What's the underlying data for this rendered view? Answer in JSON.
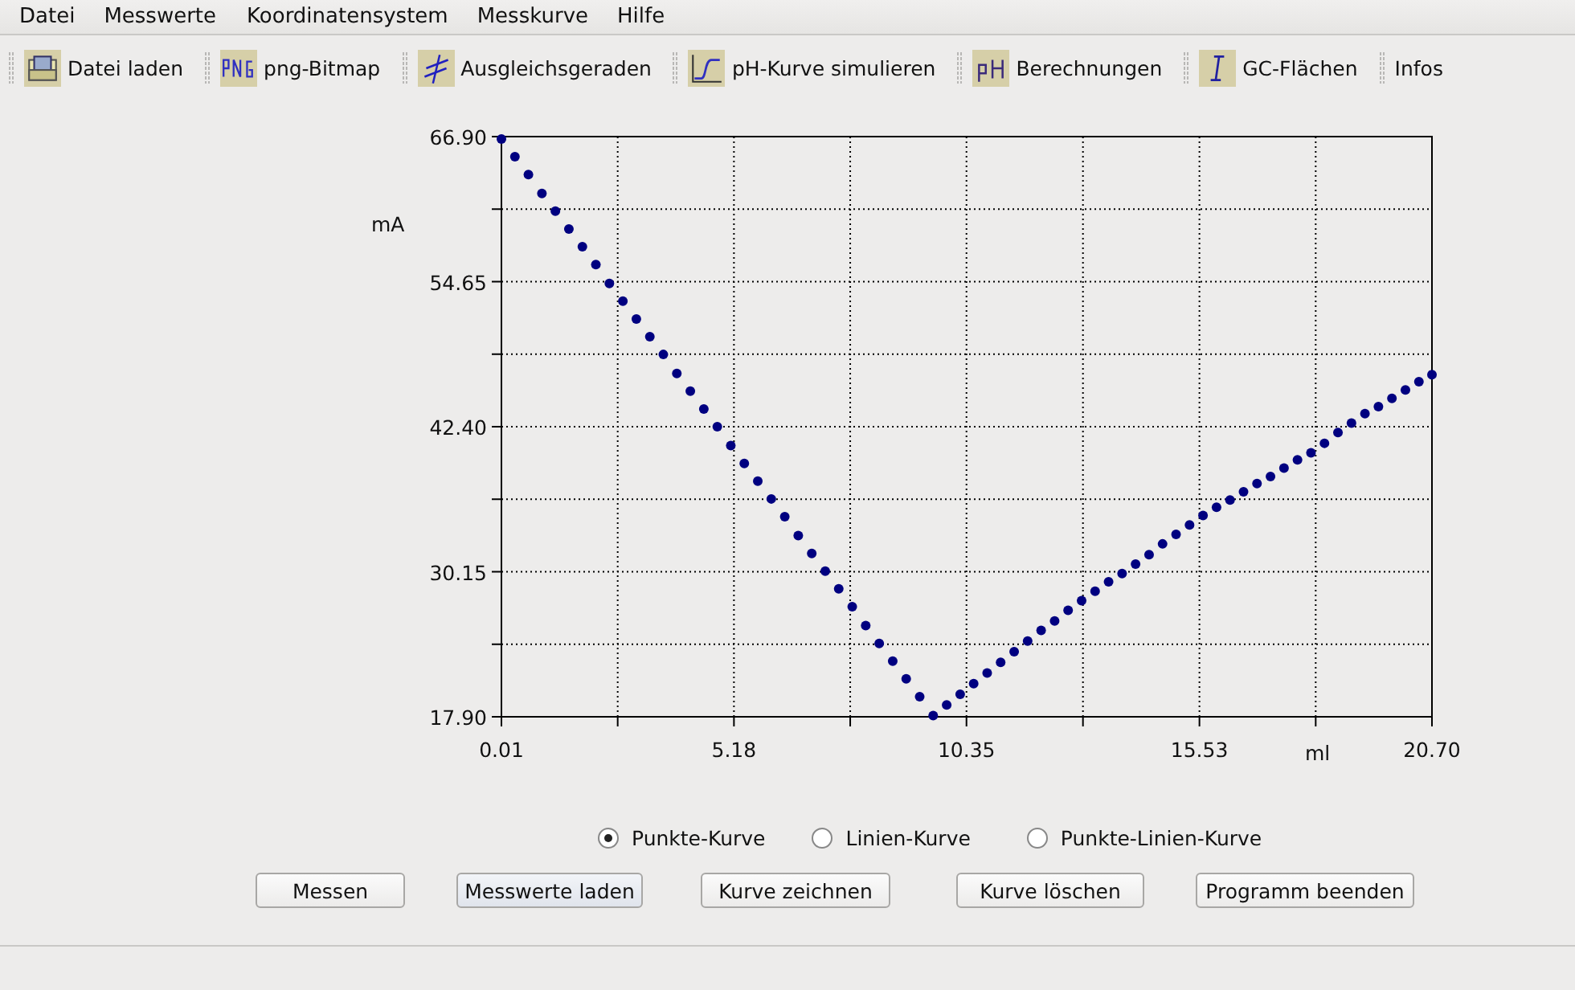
{
  "menu": [
    {
      "label": "Datei"
    },
    {
      "label": "Messwerte"
    },
    {
      "label": "Koordinatensystem"
    },
    {
      "label": "Messkurve"
    },
    {
      "label": "Hilfe"
    }
  ],
  "toolbar": [
    {
      "label": "Datei laden"
    },
    {
      "label": "png-Bitmap"
    },
    {
      "label": "Ausgleichsgeraden"
    },
    {
      "label": "pH-Kurve simulieren"
    },
    {
      "label": "Berechnungen"
    },
    {
      "label": "GC-Flächen"
    },
    {
      "label": "Infos"
    }
  ],
  "chart": {
    "chart_data": {
      "type": "scatter",
      "xlabel": "ml",
      "ylabel": "mA",
      "xlim": [
        0.01,
        20.7
      ],
      "ylim": [
        17.9,
        66.9
      ],
      "grid": true,
      "xticks": [
        {
          "value": 0.01,
          "label": "0.01"
        },
        {
          "value": 5.18,
          "label": "5.18"
        },
        {
          "value": 10.35,
          "label": "10.35"
        },
        {
          "value": 15.53,
          "label": "15.53"
        },
        {
          "value": 20.7,
          "label": "20.70"
        }
      ],
      "yticks": [
        {
          "value": 17.9,
          "label": "17.90"
        },
        {
          "value": 30.15,
          "label": "30.15"
        },
        {
          "value": 42.4,
          "label": "42.40"
        },
        {
          "value": 54.65,
          "label": "54.65"
        },
        {
          "value": 66.9,
          "label": "66.90"
        }
      ],
      "x": [
        0.01,
        0.31,
        0.61,
        0.91,
        1.21,
        1.51,
        1.81,
        2.11,
        2.41,
        2.71,
        3.01,
        3.31,
        3.61,
        3.91,
        4.21,
        4.51,
        4.81,
        5.11,
        5.41,
        5.71,
        6.01,
        6.31,
        6.61,
        6.91,
        7.21,
        7.51,
        7.81,
        8.11,
        8.41,
        8.71,
        9.01,
        9.31,
        9.61,
        9.91,
        10.21,
        10.51,
        10.81,
        11.11,
        11.41,
        11.71,
        12.01,
        12.31,
        12.61,
        12.91,
        13.21,
        13.51,
        13.81,
        14.11,
        14.41,
        14.71,
        15.01,
        15.31,
        15.61,
        15.91,
        16.21,
        16.51,
        16.81,
        17.11,
        17.41,
        17.71,
        18.01,
        18.31,
        18.61,
        18.91,
        19.21,
        19.51,
        19.81,
        20.11,
        20.41,
        20.7
      ],
      "series": [
        {
          "color": "#000080",
          "values": [
            66.7,
            65.2,
            63.7,
            62.1,
            60.6,
            59.1,
            57.6,
            56.1,
            54.5,
            53.0,
            51.5,
            50.0,
            48.5,
            46.9,
            45.4,
            43.9,
            42.4,
            40.8,
            39.3,
            37.8,
            36.3,
            34.8,
            33.2,
            31.7,
            30.2,
            28.7,
            27.2,
            25.6,
            24.1,
            22.6,
            21.1,
            19.6,
            18.0,
            18.9,
            19.8,
            20.7,
            21.6,
            22.5,
            23.4,
            24.3,
            25.2,
            26.0,
            26.9,
            27.7,
            28.5,
            29.3,
            30.0,
            30.8,
            31.6,
            32.5,
            33.3,
            34.1,
            34.9,
            35.6,
            36.2,
            36.9,
            37.6,
            38.2,
            38.9,
            39.6,
            40.2,
            41.0,
            41.9,
            42.7,
            43.5,
            44.1,
            44.8,
            45.5,
            46.2,
            46.8
          ]
        }
      ]
    }
  },
  "plot_modes": [
    {
      "label": "Punkte-Kurve",
      "selected": true
    },
    {
      "label": "Linien-Kurve",
      "selected": false
    },
    {
      "label": "Punkte-Linien-Kurve",
      "selected": false
    }
  ],
  "buttons": [
    {
      "label": "Messen",
      "hovered": false
    },
    {
      "label": "Messwerte laden",
      "hovered": true
    },
    {
      "label": "Kurve zeichnen",
      "hovered": false
    },
    {
      "label": "Kurve löschen",
      "hovered": false
    },
    {
      "label": "Programm beenden",
      "hovered": false
    }
  ]
}
